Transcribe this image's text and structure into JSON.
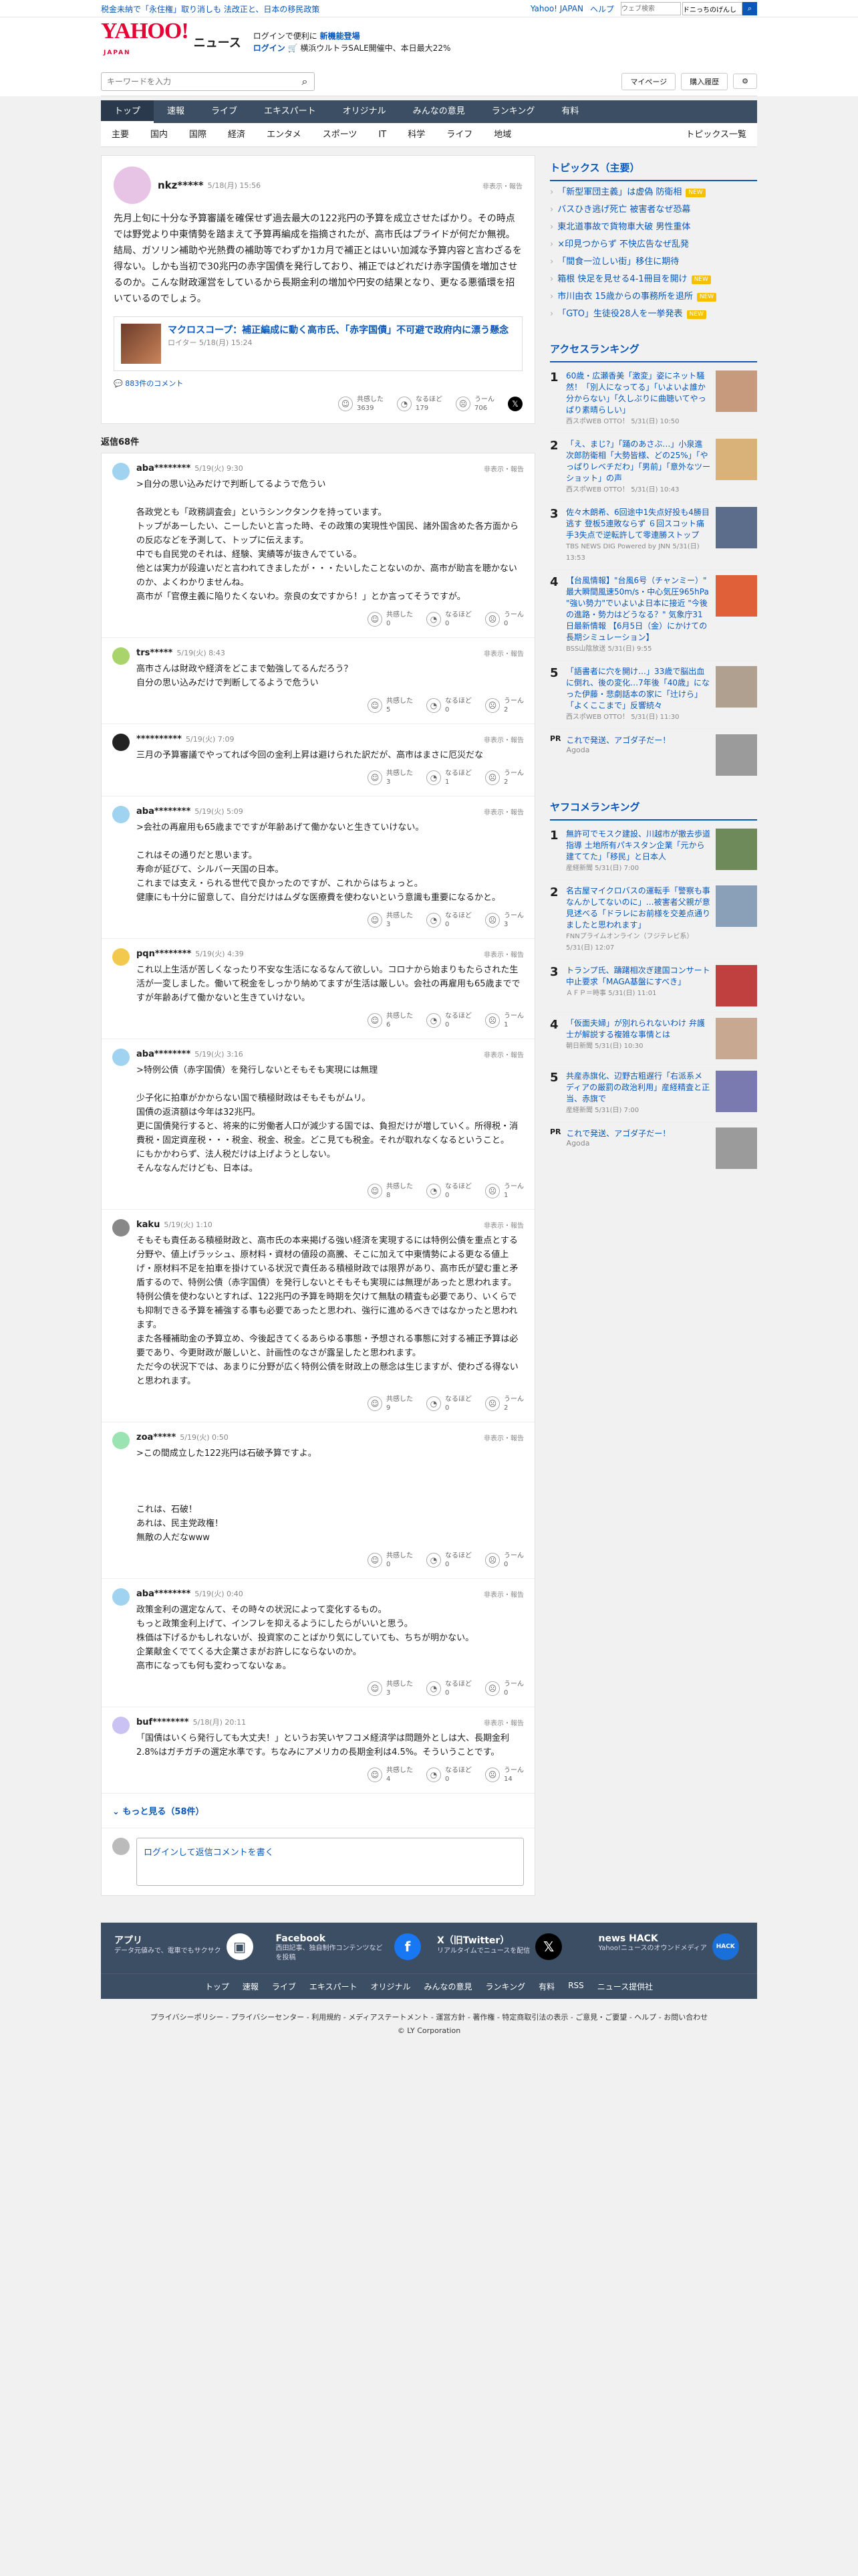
{
  "topline": {
    "left": "税金未納で「永住権」取り消しも 法改正と、日本の移民政策",
    "links": [
      "Yahoo! JAPAN",
      "ヘルプ"
    ],
    "search_placeholder": "ウェブ検索",
    "search_value": "ドニっちのげんし"
  },
  "header": {
    "logo": "YAHOO!",
    "logo_sub": "JAPAN",
    "section": "ニュース",
    "promo1": "ログインで便利に",
    "promo1b": "新機能登場",
    "promo2a": "ログイン",
    "promo2b": "🛒 横浜ウルトラSALE開催中、本日最大22%"
  },
  "search": {
    "placeholder": "キーワードを入力",
    "mypage": "マイページ",
    "purchase": "購入履歴"
  },
  "nav1": [
    "トップ",
    "速報",
    "ライブ",
    "エキスパート",
    "オリジナル",
    "みんなの意見",
    "ランキング",
    "有料"
  ],
  "nav2": [
    "主要",
    "国内",
    "国際",
    "経済",
    "エンタメ",
    "スポーツ",
    "IT",
    "科学",
    "ライフ",
    "地域"
  ],
  "nav2_right": "トピックス一覧",
  "comment": {
    "user": "nkz*****",
    "date": "5/18(月) 15:56",
    "flag": "非表示・報告",
    "text": "先月上旬に十分な予算審議を確保せず過去最大の122兆円の予算を成立させたばかり。その時点では野党より中東情勢を踏まえて予算再編成を指摘されたが、高市氏はプライドが何だか無視。結局、ガソリン補助や光熱費の補助等でわずか1カ月で補正とはいい加減な予算内容と言わざるを得ない。しかも当初で30兆円の赤字国債を発行しており、補正ではどれだけ赤字国債を増加させるのか。こんな財政運営をしているから長期金利の増加や円安の結果となり、更なる悪循環を招いているのでしょう。",
    "article_title": "マクロスコープ：補正編成に動く高市氏、「赤字国債」不可避で政府内に漂う懸念",
    "article_source": "ロイター 5/18(月) 15:24",
    "article_comments": "883件のコメント",
    "reacts": [
      {
        "label": "共感した",
        "n": "3639"
      },
      {
        "label": "なるほど",
        "n": "179"
      },
      {
        "label": "うーん",
        "n": "706"
      }
    ]
  },
  "replies_label": "返信",
  "replies_count": "68件",
  "replies": [
    {
      "user": "aba********",
      "date": "5/19(火) 9:30",
      "text": ">自分の思い込みだけで判断してるようで危うい\n\n各政党とも「政務調査会」というシンクタンクを持っています。\nトップがあーしたい、こーしたいと言った時、その政策の実現性や国民、諸外国含めた各方面からの反応などを予測して、トップに伝えます。\n中でも自民党のそれは、経験、実績等が抜きんでている。\n他とは実力が段違いだと言われてきましたが・・・たいしたことないのか、高市が助言を聴かないのか、よくわかりませんね。\n高市が「官僚主義に陥りたくないわ。奈良の女ですから！」とか言ってそうですが。",
      "r": [
        "0",
        "0",
        "0"
      ]
    },
    {
      "user": "trs*****",
      "date": "5/19(火) 8:43",
      "text": "高市さんは財政や経済をどこまで勉強してるんだろう？\n自分の思い込みだけで判断してるようで危うい",
      "r": [
        "5",
        "0",
        "2"
      ]
    },
    {
      "user": "**********",
      "date": "5/19(火) 7:09",
      "text": "三月の予算審議でやってれば今回の金利上昇は避けられた訳だが、高市はまさに厄災だな",
      "r": [
        "3",
        "1",
        "2"
      ]
    },
    {
      "user": "aba********",
      "date": "5/19(火) 5:09",
      "text": ">会社の再雇用も65歳までですが年齢あげて働かないと生きていけない。\n\nこれはその通りだと思います。\n寿命が延びて、シルバー天国の日本。\nこれまでは支え・られる世代で良かったのですが、これからはちょっと。\n健康にも十分に留意して、自分だけはムダな医療費を使わないという意識も重要になるかと。",
      "r": [
        "3",
        "0",
        "3"
      ]
    },
    {
      "user": "pqn********",
      "date": "5/19(火) 4:39",
      "text": "これ以上生活が苦しくなったり不安な生活になるなんて欲しい。コロナから始まりもたらされた生活が一変しました。働いて税金をしっかり納めてますが生活は厳しい。会社の再雇用も65歳までですが年齢あげて働かないと生きていけない。",
      "r": [
        "6",
        "0",
        "1"
      ]
    },
    {
      "user": "aba********",
      "date": "5/19(火) 3:16",
      "text": ">特例公債（赤字国債）を発行しないとそもそも実現には無理\n\n少子化に拍車がかからない国で積極財政はそもそもがムリ。\n国債の返済額は今年は32兆円。\n更に国債発行すると、将来的に労働者人口が減少する国では、負担だけが増していく。所得税・消費税・固定資産税・・・税金、税金、税金。どこ見ても税金。それが取れなくなるということ。\nにもかかわらず、法人税だけは上げようとしない。\nそんななんだけども、日本は。",
      "r": [
        "8",
        "0",
        "1"
      ]
    },
    {
      "user": "kaku",
      "date": "5/19(火) 1:10",
      "text": "そもそも責任ある積極財政と、高市氏の本来掲げる強い経済を実現するには特例公債を重点とする分野や、値上げラッシュ、原材料・資材の値段の高騰、そこに加えて中東情勢による更なる値上げ・原材料不足を拍車を掛けている状況で責任ある積極財政では限界があり、高市氏が望む重と矛盾するので、特例公債（赤字国債）を発行しないとそもそも実現には無理があったと思われます。\n特例公債を使わないとすれば、122兆円の予算を時期を欠けて無駄の精査も必要であり、いくらでも抑制できる予算を補強する事も必要であったと思われ、強行に進めるべきではなかったと思われます。\nまた各種補助金の予算立め、今後起きてくるあらゆる事態・予想される事態に対する補正予算は必要であり、今更財政が厳しいと、計画性のなさが露呈したと思われます。\nただ今の状況下では、あまりに分野が広く特例公債を財政上の懸念は生じますが、使わざる得ないと思われます。",
      "r": [
        "9",
        "0",
        "2"
      ]
    },
    {
      "user": "zoa*****",
      "date": "5/19(火) 0:50",
      "text": ">この間成立した122兆円は石破予算ですよ。\n\n\n\nこれは、石破！\nあれは、民主党政権！\n無敵の人だなwww",
      "r": [
        "0",
        "0",
        "0"
      ]
    },
    {
      "user": "aba********",
      "date": "5/19(火) 0:40",
      "text": "政策金利の選定なんて、その時々の状況によって変化するもの。\nもっと政策金利上げて、インフレを抑えるようにしたらがいいと思う。\n株価は下げるかもしれないが、投資家のことばかり気にしていても、ちちが明かない。\n企業献金くでてくる大企業さまがお許しにならないのか。\n高市になっても何も変わってないなぁ。",
      "r": [
        "3",
        "0",
        "0"
      ]
    },
    {
      "user": "buf********",
      "date": "5/18(月) 20:11",
      "text": "「国債はいくら発行しても大丈夫！」というお笑いヤフコメ経済学は問題外としは大、長期金利2.8%はガチガチの選定水準です。ちなみにアメリカの長期金利は4.5%。そういうことです。",
      "r": [
        "4",
        "0",
        "14"
      ]
    }
  ],
  "more": "もっと見る（58件）",
  "login_prompt": "ログインして返信コメントを書く",
  "react_labels": [
    "共感した",
    "なるほど",
    "うーん"
  ],
  "topics": {
    "title": "トピックス（主要）",
    "items": [
      {
        "t": "「新型軍団主義」は虚偽 防衛相",
        "new": true
      },
      {
        "t": "バスひき逃げ死亡 被害者なぜ恐幕",
        "new": false
      },
      {
        "t": "東北道事故で貨物車大破 男性重体",
        "new": false
      },
      {
        "t": "×印見つからず 不快広告なぜ乱発",
        "new": false
      },
      {
        "t": "「間食一泣しい街」移住に期待",
        "new": false
      },
      {
        "t": "箱根 快足を見せる4-1冊目を開け",
        "new": true
      },
      {
        "t": "市川由衣 15歳からの事務所を退所",
        "new": true
      },
      {
        "t": "「GTO」生徒役28人を一挙発表",
        "new": true
      }
    ]
  },
  "access": {
    "title": "アクセスランキング",
    "items": [
      {
        "t": "60歳・広瀬香美「激変」姿にネット騒然！「別人になってる」「いよいよ誰か分からない」「久しぶりに曲聴いてやっぱり素晴らしい」",
        "s": "西スポWEB OTTO！ 5/31(日) 10:50"
      },
      {
        "t": "「え、まじ?」「踊のあさぶ…」小泉進次郎防衛相「大勢皆様、どの25%」「やっぱりレベチだわ」「男前」「意外なツーショット」の声",
        "s": "西スポWEB OTTO！ 5/31(日) 10:43"
      },
      {
        "t": "佐々木朗希、6回途中1失点好投も4勝目逃す 登板5連敗ならず ６回スコット痛手3失点で逆転許して零連勝ストップ",
        "s": "TBS NEWS DIG Powered by JNN 5/31(日) 13:53"
      },
      {
        "t": "【台風情報】\"台風6号（チャンミー）\" 最大瞬間風速50m/s・中心気圧965hPa \"強い勢力\"でいよいよ日本に接近 \"今後の進路・勢力はどうなる？\" 気象庁31日最新情報 【6月5日（金）にかけての長期シミュレーション】",
        "s": "BSS山陰放送 5/31(日) 9:55"
      },
      {
        "t": "「語書者に穴を開け…」33歳で脳出血に倒れ、後の変化…7年後「40歳」になった伊藤・悲劇話本の家に「辻けら」「よくここまで」反響続々",
        "s": "西スポWEB OTTO！ 5/31(日) 11:30"
      }
    ]
  },
  "ad1": {
    "pr": "PR",
    "t": "これで発送、アゴダ子だー！",
    "s": "Agoda"
  },
  "yafukome": {
    "title": "ヤフコメランキング",
    "items": [
      {
        "t": "無許可でモスク建設、川越市が撤去歩道指導 土地所有パキスタン企業「元から建ててた」「移民」と日本人",
        "s": "産経新聞 5/31(日) 7:00"
      },
      {
        "t": "名古屋マイクロバスの運転手「警察も事なんかしてないのに」…被害者父親が意見述べる「ドラレにお前様を交差点通りましたと思われます」",
        "s": "FNNプライムオンライン（フジテレビ系） 5/31(日) 12:07"
      },
      {
        "t": "トランプ氏、躊躇相次ぎ建国コンサート中止要求「MAGA基盤にすべき」",
        "s": "ＡＦＰ＝時事 5/31(日) 11:01"
      },
      {
        "t": "「仮面夫婦」が別れられないわけ 弁護士が解説する複雑な事情とは",
        "s": "朝日新聞 5/31(日) 10:30"
      },
      {
        "t": "共産赤旗化、辺野古粗遅行「右派系メディアの厳罰の政治利用」産経精査と正当、赤旗で",
        "s": "産経新聞 5/31(日) 7:00"
      }
    ]
  },
  "ad2": {
    "pr": "PR",
    "t": "これで発送、アゴダ子だー！",
    "s": "Agoda"
  },
  "footer": {
    "apps": [
      {
        "t": "アプリ",
        "d": "データ元値みで、電車でもサクサク"
      },
      {
        "t": "Facebook",
        "d": "西田記事、独自制作コンテンツなどを投稿"
      },
      {
        "t": "X（旧Twitter）",
        "d": "リアルタイムでニュースを配信"
      },
      {
        "t": "news HACK",
        "d": "Yahoo!ニュースのオウンドメディア"
      }
    ],
    "nav": [
      "トップ",
      "速報",
      "ライブ",
      "エキスパート",
      "オリジナル",
      "みんなの意見",
      "ランキング",
      "有料",
      "RSS",
      "ニュース提供社"
    ],
    "links": "プライバシーポリシー - プライバシーセンター - 利用規約 - メディアステートメント - 運営方針 - 著作権 - 特定商取引法の表示 - ご意見・ご要望 - ヘルプ - お問い合わせ",
    "copy": "© LY Corporation"
  }
}
